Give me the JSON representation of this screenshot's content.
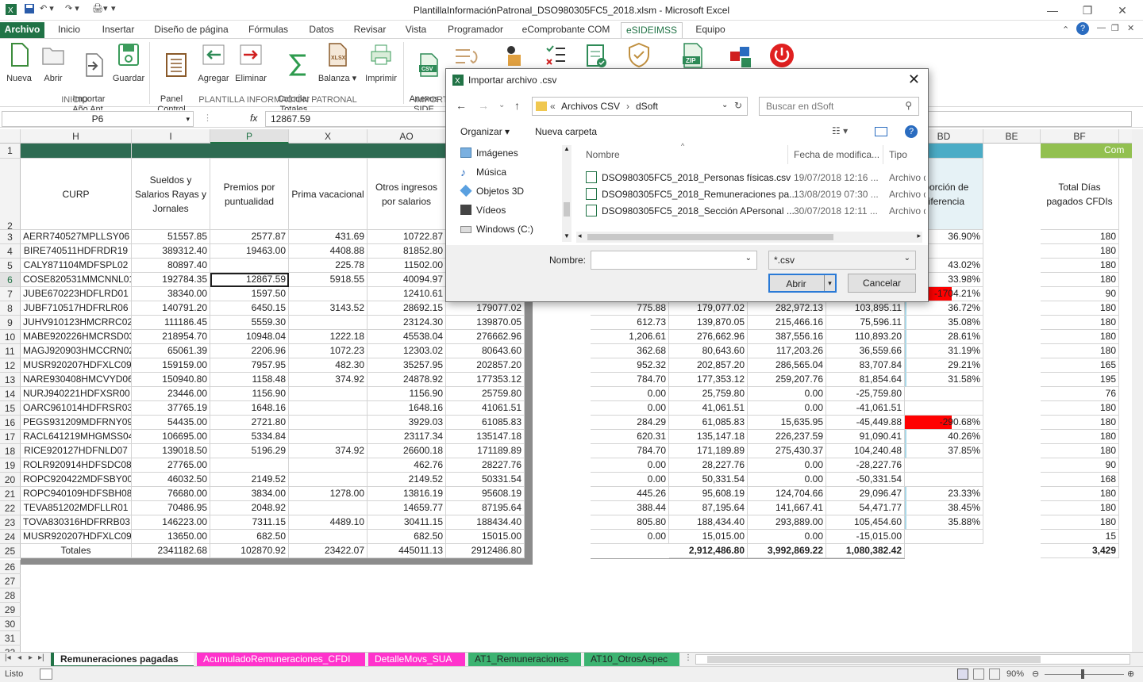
{
  "window": {
    "title": "PlantillaInformaciónPatronal_DSO980305FC5_2018.xlsm - Microsoft Excel"
  },
  "tabs": [
    "Archivo",
    "Inicio",
    "Insertar",
    "Diseño de página",
    "Fórmulas",
    "Datos",
    "Revisar",
    "Vista",
    "Programador",
    "eComprobante COM",
    "eSIDEIMSS",
    "Equipo"
  ],
  "active_tab": "eSIDEIMSS",
  "ribbon": {
    "buttons": [
      {
        "label": "Nueva",
        "icon": "new-file-icon"
      },
      {
        "label": "Abrir",
        "icon": "open-folder-icon"
      },
      {
        "label": "Importar\nAño Ant.",
        "icon": "import-icon"
      },
      {
        "label": "Guardar",
        "icon": "save-icon"
      },
      {
        "label": "Panel\nControl",
        "icon": "panel-icon"
      },
      {
        "label": "Agregar",
        "icon": "add-row-icon"
      },
      {
        "label": "Eliminar",
        "icon": "delete-row-icon"
      },
      {
        "label": "Calcular\nTotales",
        "icon": "sigma-icon"
      },
      {
        "label": "Balanza",
        "icon": "xlsx-icon"
      },
      {
        "label": "Imprimir",
        "icon": "printer-icon"
      },
      {
        "label": "Anexos\nSIDE",
        "icon": "csv-icon"
      }
    ],
    "groups": [
      "INICIO",
      "PLANTILLA INFORMACIÓN PATRONAL",
      "IMPORT"
    ]
  },
  "formula_bar": {
    "name_box": "P6",
    "fx": "fx",
    "value": "12867.59"
  },
  "columns_left": [
    "H",
    "I",
    "P",
    "X",
    "AO"
  ],
  "columns_right": [
    "BD",
    "BE",
    "BF"
  ],
  "header_row2": {
    "H": "CURP",
    "I": "Sueldos y Salarios Rayas y Jornales",
    "P": "Premios por puntualidad",
    "X": "Prima vacacional",
    "AO": "Otros ingresos por salarios",
    "BD": "oporción de diferencia",
    "BF": "Total Días pagados CFDIs",
    "BF_top": "Com"
  },
  "rows": [
    {
      "r": "3",
      "curp": "AERR740527MPLLSY06",
      "i": "51557.85",
      "p": "2577.87",
      "x": "431.69",
      "ao": "10722.87",
      "c1": "",
      "c2": "",
      "c3": "",
      "c4": "",
      "c5": "",
      "bd": "36.90%",
      "bf": "180"
    },
    {
      "r": "4",
      "curp": "BIRE740511HDFRDR19",
      "i": "389312.40",
      "p": "19463.00",
      "x": "4408.88",
      "ao": "81852.80",
      "c1": "",
      "c2": "",
      "c3": "",
      "c4": "",
      "c5": "",
      "bd": "",
      "bf": "180"
    },
    {
      "r": "5",
      "curp": "CALY871104MDFSPL02",
      "i": "80897.40",
      "p": "",
      "x": "225.78",
      "ao": "11502.00",
      "c1": "",
      "c2": "",
      "c3": "",
      "c4": "",
      "c5": "",
      "bd": "43.02%",
      "bf": "180"
    },
    {
      "r": "6",
      "curp": "COSE820531MMCNNL01",
      "i": "192784.35",
      "p": "12867.59",
      "x": "5918.55",
      "ao": "40094.97",
      "c1": "",
      "c2": "",
      "c3": "",
      "c4": "",
      "c5": "",
      "bd": "33.98%",
      "bf": "180"
    },
    {
      "r": "7",
      "curp": "JUBE670223HDFLRD01",
      "i": "38340.00",
      "p": "1597.50",
      "x": "",
      "ao": "12410.61",
      "c1": "",
      "c2": "",
      "c3": "",
      "c4": "",
      "c5": "",
      "bd": "-1704.21%",
      "bf": "90"
    },
    {
      "r": "8",
      "curp": "JUBF710517HDFRLR06",
      "i": "140791.20",
      "p": "6450.15",
      "x": "3143.52",
      "ao": "28692.15",
      "c1": "179077.02",
      "c2": "775.88",
      "c3": "179,077.02",
      "c4": "282,972.13",
      "c5": "103,895.11",
      "bd": "36.72%",
      "bf": "180"
    },
    {
      "r": "9",
      "curp": "JUHV910123HMCRRC02",
      "i": "111186.45",
      "p": "5559.30",
      "x": "",
      "ao": "23124.30",
      "c1": "139870.05",
      "c2": "612.73",
      "c3": "139,870.05",
      "c4": "215,466.16",
      "c5": "75,596.11",
      "bd": "35.08%",
      "bf": "180"
    },
    {
      "r": "10",
      "curp": "MABE920226HMCRSD03",
      "i": "218954.70",
      "p": "10948.04",
      "x": "1222.18",
      "ao": "45538.04",
      "c1": "276662.96",
      "c2": "1,206.61",
      "c3": "276,662.96",
      "c4": "387,556.16",
      "c5": "110,893.20",
      "bd": "28.61%",
      "bf": "180"
    },
    {
      "r": "11",
      "curp": "MAGJ920903HMCCRN02",
      "i": "65061.39",
      "p": "2206.96",
      "x": "1072.23",
      "ao": "12303.02",
      "c1": "80643.60",
      "c2": "362.68",
      "c3": "80,643.60",
      "c4": "117,203.26",
      "c5": "36,559.66",
      "bd": "31.19%",
      "bf": "180"
    },
    {
      "r": "12",
      "curp": "MUSR920207HDFXLC09",
      "i": "159159.00",
      "p": "7957.95",
      "x": "482.30",
      "ao": "35257.95",
      "c1": "202857.20",
      "c2": "952.32",
      "c3": "202,857.20",
      "c4": "286,565.04",
      "c5": "83,707.84",
      "bd": "29.21%",
      "bf": "165"
    },
    {
      "r": "13",
      "curp": "NARE930408HMCVYD06",
      "i": "150940.80",
      "p": "1158.48",
      "x": "374.92",
      "ao": "24878.92",
      "c1": "177353.12",
      "c2": "784.70",
      "c3": "177,353.12",
      "c4": "259,207.76",
      "c5": "81,854.64",
      "bd": "31.58%",
      "bf": "195"
    },
    {
      "r": "14",
      "curp": "NURJ940221HDFXSR00",
      "i": "23446.00",
      "p": "1156.90",
      "x": "",
      "ao": "1156.90",
      "c1": "25759.80",
      "c2": "0.00",
      "c3": "25,759.80",
      "c4": "0.00",
      "c5": "-25,759.80",
      "bd": "",
      "bf": "76"
    },
    {
      "r": "15",
      "curp": "OARC961014HDFRSR03",
      "i": "37765.19",
      "p": "1648.16",
      "x": "",
      "ao": "1648.16",
      "c1": "41061.51",
      "c2": "0.00",
      "c3": "41,061.51",
      "c4": "0.00",
      "c5": "-41,061.51",
      "bd": "",
      "bf": "180"
    },
    {
      "r": "16",
      "curp": "PEGS931209MDFRNY09",
      "i": "54435.00",
      "p": "2721.80",
      "x": "",
      "ao": "3929.03",
      "c1": "61085.83",
      "c2": "284.29",
      "c3": "61,085.83",
      "c4": "15,635.95",
      "c5": "-45,449.88",
      "bd": "-290.68%",
      "bf": "180"
    },
    {
      "r": "17",
      "curp": "RACL641219MHGMSS04",
      "i": "106695.00",
      "p": "5334.84",
      "x": "",
      "ao": "23117.34",
      "c1": "135147.18",
      "c2": "620.31",
      "c3": "135,147.18",
      "c4": "226,237.59",
      "c5": "91,090.41",
      "bd": "40.26%",
      "bf": "180"
    },
    {
      "r": "18",
      "curp": "RICE920127HDFNLD07",
      "i": "139018.50",
      "p": "5196.29",
      "x": "374.92",
      "ao": "26600.18",
      "c1": "171189.89",
      "c2": "784.70",
      "c3": "171,189.89",
      "c4": "275,430.37",
      "c5": "104,240.48",
      "bd": "37.85%",
      "bf": "180"
    },
    {
      "r": "19",
      "curp": "ROLR920914HDFSDC08",
      "i": "27765.00",
      "p": "",
      "x": "",
      "ao": "462.76",
      "c1": "28227.76",
      "c2": "0.00",
      "c3": "28,227.76",
      "c4": "0.00",
      "c5": "-28,227.76",
      "bd": "",
      "bf": "90"
    },
    {
      "r": "20",
      "curp": "ROPC920422MDFSBY00",
      "i": "46032.50",
      "p": "2149.52",
      "x": "",
      "ao": "2149.52",
      "c1": "50331.54",
      "c2": "0.00",
      "c3": "50,331.54",
      "c4": "0.00",
      "c5": "-50,331.54",
      "bd": "",
      "bf": "168"
    },
    {
      "r": "21",
      "curp": "ROPC940109HDFSBH08",
      "i": "76680.00",
      "p": "3834.00",
      "x": "1278.00",
      "ao": "13816.19",
      "c1": "95608.19",
      "c2": "445.26",
      "c3": "95,608.19",
      "c4": "124,704.66",
      "c5": "29,096.47",
      "bd": "23.33%",
      "bf": "180"
    },
    {
      "r": "22",
      "curp": "TEVA851202MDFLLR01",
      "i": "70486.95",
      "p": "2048.92",
      "x": "",
      "ao": "14659.77",
      "c1": "87195.64",
      "c2": "388.44",
      "c3": "87,195.64",
      "c4": "141,667.41",
      "c5": "54,471.77",
      "bd": "38.45%",
      "bf": "180"
    },
    {
      "r": "23",
      "curp": "TOVA830316HDFRRB03",
      "i": "146223.00",
      "p": "7311.15",
      "x": "4489.10",
      "ao": "30411.15",
      "c1": "188434.40",
      "c2": "805.80",
      "c3": "188,434.40",
      "c4": "293,889.00",
      "c5": "105,454.60",
      "bd": "35.88%",
      "bf": "180"
    },
    {
      "r": "24",
      "curp": "MUSR920207HDFXLC09",
      "i": "13650.00",
      "p": "682.50",
      "x": "",
      "ao": "682.50",
      "c1": "15015.00",
      "c2": "0.00",
      "c3": "15,015.00",
      "c4": "0.00",
      "c5": "-15,015.00",
      "bd": "",
      "bf": "15"
    }
  ],
  "totals": {
    "r": "25",
    "label": "Totales",
    "i": "2341182.68",
    "p": "102870.92",
    "x": "23422.07",
    "ao": "445011.13",
    "c1": "2912486.80",
    "c3": "2,912,486.80",
    "c4": "3,992,869.22",
    "c5": "1,080,382.42",
    "bf": "3,429"
  },
  "extra_rows": [
    "26",
    "27",
    "28",
    "29",
    "30",
    "31",
    "32"
  ],
  "row_labels_top": [
    "1",
    "2"
  ],
  "dialog": {
    "title": "Importar archivo .csv",
    "path_prefix": "«",
    "path1": "Archivos CSV",
    "path_sep": "›",
    "path2": "dSoft",
    "search_placeholder": "Buscar en dSoft",
    "organize": "Organizar",
    "new_folder": "Nueva carpeta",
    "nav": [
      "Imágenes",
      "Música",
      "Objetos 3D",
      "Vídeos",
      "Windows (C:)"
    ],
    "headers": {
      "name": "Nombre",
      "date": "Fecha de modifica...",
      "type": "Tipo"
    },
    "files": [
      {
        "name": "DSO980305FC5_2018_Personas físicas.csv",
        "date": "19/07/2018 12:16 ...",
        "type": "Archivo d"
      },
      {
        "name": "DSO980305FC5_2018_Remuneraciones pa...",
        "date": "13/08/2019 07:30 ...",
        "type": "Archivo d"
      },
      {
        "name": "DSO980305FC5_2018_Sección APersonal ...",
        "date": "30/07/2018 12:11 ...",
        "type": "Archivo d"
      }
    ],
    "filename_label": "Nombre:",
    "filename_value": "",
    "filter": "*.csv",
    "open": "Abrir",
    "cancel": "Cancelar"
  },
  "sheet_tabs": [
    {
      "label": "Remuneraciones pagadas",
      "active": true
    },
    {
      "label": "AcumuladoRemuneraciones_CFDI",
      "color": "#ff33cc"
    },
    {
      "label": "DetalleMovs_SUA",
      "color": "#ff33cc"
    },
    {
      "label": "AT1_Remuneraciones",
      "color": "#3cb371"
    },
    {
      "label": "AT10_OtrosAspec",
      "color": "#3cb371"
    }
  ],
  "status": {
    "ready": "Listo",
    "zoom": "90%"
  },
  "colors": {
    "excel_green": "#217346",
    "header_dark": "#2e6b52",
    "header_teal": "#4bacc6",
    "header_lime": "#92c050",
    "neg_red": "#ff0000",
    "pink_tab": "#ff33cc"
  }
}
